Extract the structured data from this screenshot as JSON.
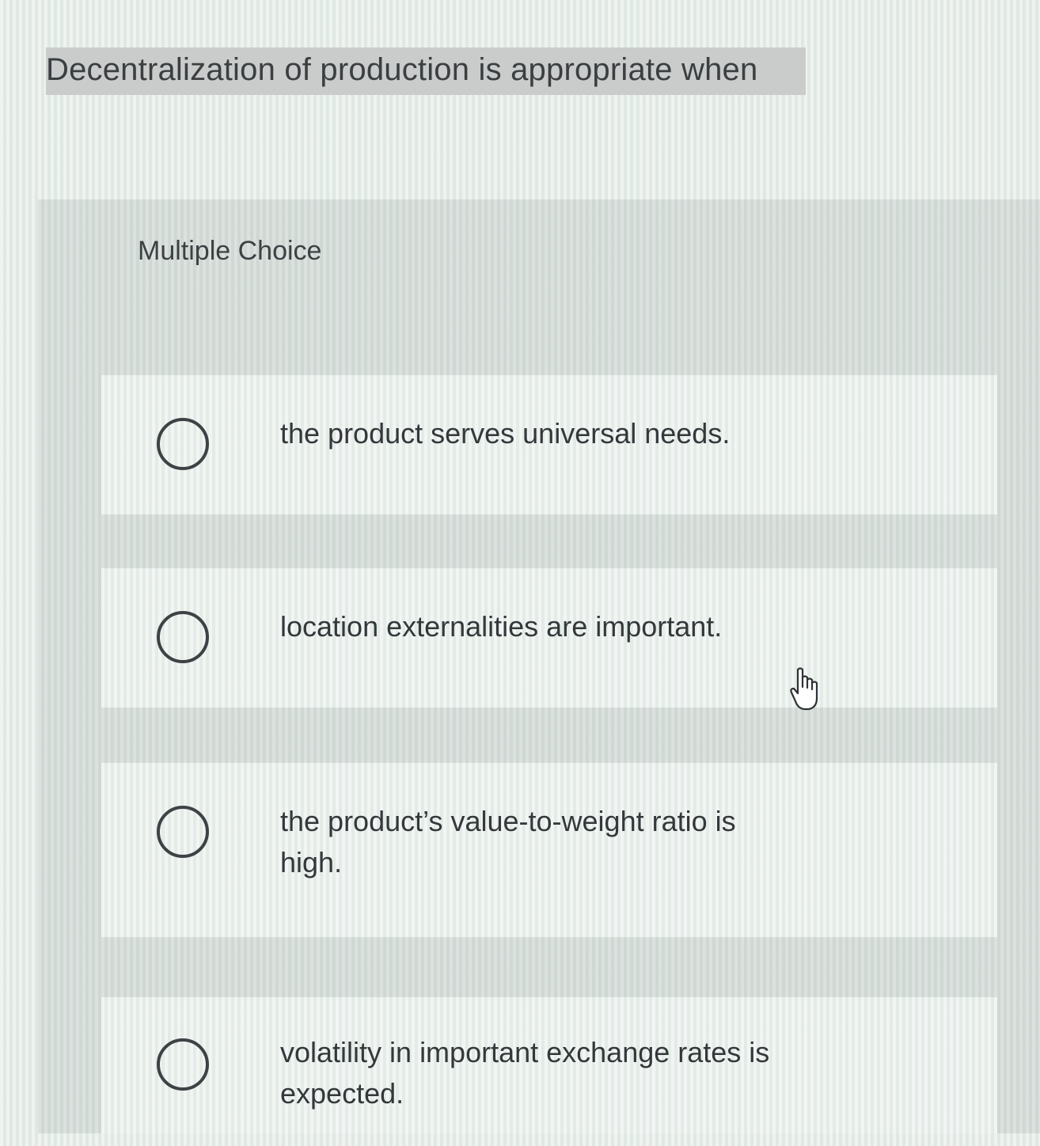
{
  "question": {
    "text": "Decentralization of production is appropriate when"
  },
  "section_label": "Multiple Choice",
  "options": [
    {
      "label": "the product serves universal needs.",
      "selected": false
    },
    {
      "label": "location externalities are important.",
      "selected": false
    },
    {
      "label": "the product’s value-to-weight ratio is high.",
      "selected": false
    },
    {
      "label": "volatility in important exchange rates is expected.",
      "selected": false
    }
  ],
  "cursor_icon": "hand-pointer-icon"
}
